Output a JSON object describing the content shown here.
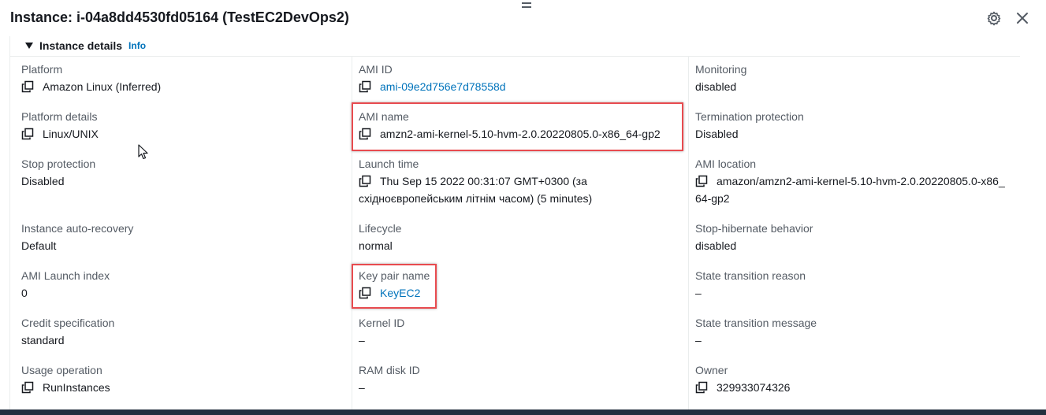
{
  "header": {
    "title": "Instance: i-04a8dd4530fd05164 (TestEC2DevOps2)"
  },
  "section": {
    "title": "Instance details",
    "info_link": "Info"
  },
  "fields": [
    {
      "label": "Platform",
      "value": "Amazon Linux (Inferred)",
      "copy": true,
      "link": false
    },
    {
      "label": "AMI ID",
      "value": "ami-09e2d756e7d78558d",
      "copy": true,
      "link": true
    },
    {
      "label": "Monitoring",
      "value": "disabled",
      "copy": false,
      "link": false
    },
    {
      "label": "Platform details",
      "value": "Linux/UNIX",
      "copy": true,
      "link": false
    },
    {
      "label": "AMI name",
      "value": "amzn2-ami-kernel-5.10-hvm-2.0.20220805.0-x86_64-gp2",
      "copy": true,
      "link": false
    },
    {
      "label": "Termination protection",
      "value": "Disabled",
      "copy": false,
      "link": false
    },
    {
      "label": "Stop protection",
      "value": "Disabled",
      "copy": false,
      "link": false
    },
    {
      "label": "Launch time",
      "value": "Thu Sep 15 2022 00:31:07 GMT+0300 (за східноєвропейським літнім часом) (5 minutes)",
      "copy": true,
      "link": false
    },
    {
      "label": "AMI location",
      "value": "amazon/amzn2-ami-kernel-5.10-hvm-2.0.20220805.0-x86_64-gp2",
      "copy": true,
      "link": false
    },
    {
      "label": "Instance auto-recovery",
      "value": "Default",
      "copy": false,
      "link": false
    },
    {
      "label": "Lifecycle",
      "value": "normal",
      "copy": false,
      "link": false
    },
    {
      "label": "Stop-hibernate behavior",
      "value": "disabled",
      "copy": false,
      "link": false
    },
    {
      "label": "AMI Launch index",
      "value": "0",
      "copy": false,
      "link": false
    },
    {
      "label": "Key pair name",
      "value": "KeyEC2",
      "copy": true,
      "link": true
    },
    {
      "label": "State transition reason",
      "value": "–",
      "copy": false,
      "link": false
    },
    {
      "label": "Credit specification",
      "value": "standard",
      "copy": false,
      "link": false
    },
    {
      "label": "Kernel ID",
      "value": "–",
      "copy": false,
      "link": false
    },
    {
      "label": "State transition message",
      "value": "–",
      "copy": false,
      "link": false
    },
    {
      "label": "Usage operation",
      "value": "RunInstances",
      "copy": true,
      "link": false
    },
    {
      "label": "RAM disk ID",
      "value": "–",
      "copy": false,
      "link": false
    },
    {
      "label": "Owner",
      "value": "329933074326",
      "copy": true,
      "link": false
    }
  ],
  "colors": {
    "link": "#0073bb",
    "highlight": "#e84b4f",
    "label": "#545b64"
  },
  "icons": {
    "copy": "copy-icon",
    "settings": "gear-icon",
    "close": "close-icon",
    "drag": "drag-handle-icon",
    "caret": "caret-down-icon"
  }
}
